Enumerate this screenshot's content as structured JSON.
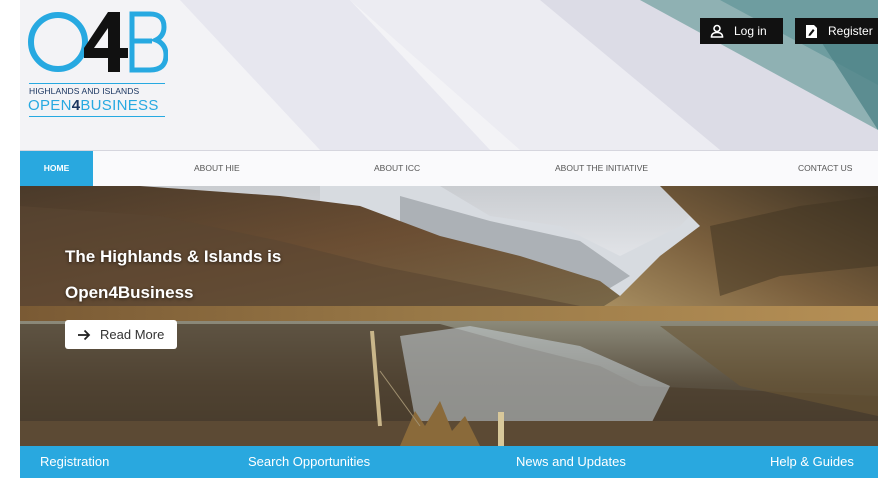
{
  "logo": {
    "sub_line_1": "HIGHLANDS AND ISLANDS",
    "sub_line_2_a": "OPEN",
    "sub_line_2_b": "4",
    "sub_line_2_c": "BUSINESS",
    "main_text": "O4B"
  },
  "auth": {
    "login_label": "Log in",
    "register_label": "Register"
  },
  "nav": {
    "items": [
      {
        "label": "HOME"
      },
      {
        "label": "ABOUT HIE"
      },
      {
        "label": "ABOUT ICC"
      },
      {
        "label": "ABOUT THE INITIATIVE"
      },
      {
        "label": "CONTACT US"
      }
    ]
  },
  "hero": {
    "title_line_1": "The Highlands & Islands is",
    "title_line_2": "Open4Business",
    "read_more_label": "Read More"
  },
  "bottom_bar": {
    "items": [
      {
        "label": "Registration"
      },
      {
        "label": "Search Opportunities"
      },
      {
        "label": "News and Updates"
      },
      {
        "label": "Help & Guides"
      }
    ]
  },
  "colors": {
    "accent": "#29a8df",
    "logo_navy": "#1a3560",
    "auth_bg": "#111111"
  }
}
